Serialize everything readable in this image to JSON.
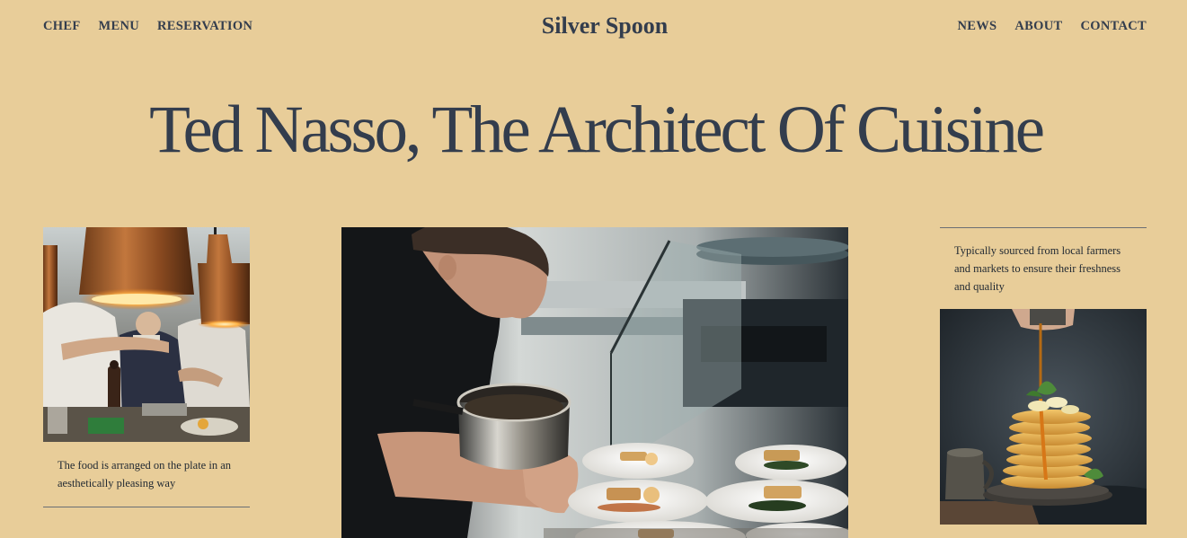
{
  "header": {
    "nav_left": [
      "CHEF",
      "MENU",
      "RESERVATION"
    ],
    "brand": "Silver Spoon",
    "nav_right": [
      "NEWS",
      "ABOUT",
      "CONTACT"
    ]
  },
  "hero": {
    "title": "Ted Nasso, The Architect Of Cuisine"
  },
  "left_card": {
    "caption": "The food is arranged on the plate in an aesthetically pleasing way"
  },
  "right_card": {
    "caption": "Typically sourced from local farmers and markets to ensure their freshness and quality"
  },
  "colors": {
    "background": "#e8cd99",
    "text": "#333d4d",
    "rule": "#6a6e74"
  }
}
